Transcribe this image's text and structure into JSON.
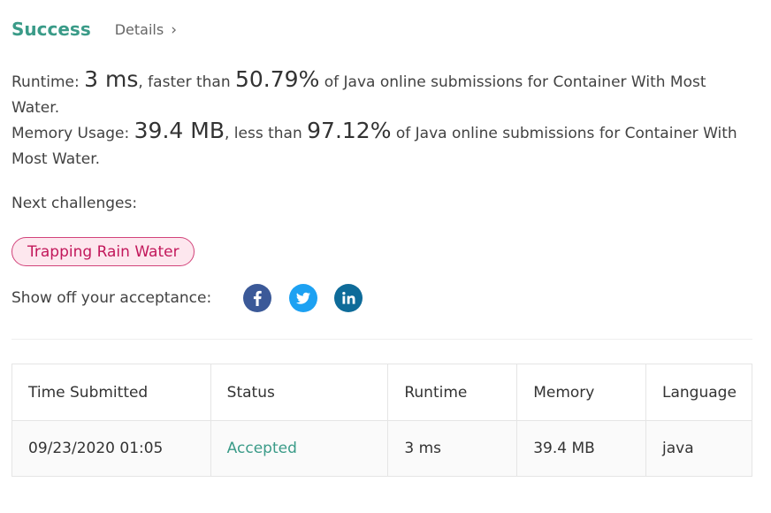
{
  "header": {
    "status": "Success",
    "details_label": "Details"
  },
  "runtime": {
    "prefix": "Runtime: ",
    "value": "3 ms",
    "mid": ", faster than ",
    "percent": "50.79%",
    "suffix": " of Java online submissions for Container With Most Water."
  },
  "memory": {
    "prefix": "Memory Usage: ",
    "value": "39.4 MB",
    "mid": ", less than ",
    "percent": "97.12%",
    "suffix": " of Java online submissions for Container With Most Water."
  },
  "next": {
    "label": "Next challenges:",
    "challenges": [
      "Trapping Rain Water"
    ]
  },
  "share": {
    "label": "Show off your acceptance:",
    "icons": [
      "facebook-icon",
      "twitter-icon",
      "linkedin-icon"
    ]
  },
  "table": {
    "headers": [
      "Time Submitted",
      "Status",
      "Runtime",
      "Memory",
      "Language"
    ],
    "rows": [
      [
        "09/23/2020 01:05",
        "Accepted",
        "3 ms",
        "39.4 MB",
        "java"
      ]
    ]
  },
  "colors": {
    "success": "#3a9b88",
    "challenge_tag": "#c2185b",
    "facebook": "#3b5998",
    "twitter": "#1da1f2",
    "linkedin": "#0e6b99"
  }
}
